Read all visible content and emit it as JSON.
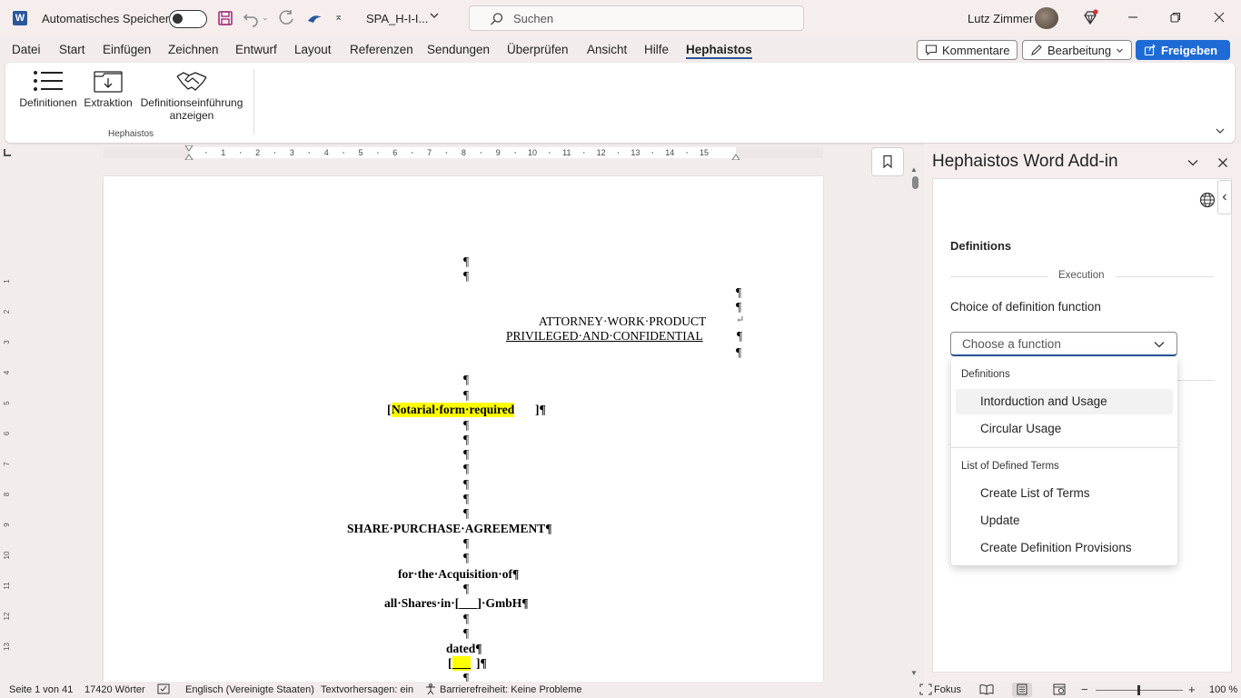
{
  "titlebar": {
    "autosave_label": "Automatisches Speichern",
    "filename": "SPA_H-I-I...",
    "search_placeholder": "Suchen",
    "user_name": "Lutz Zimmer"
  },
  "menu": {
    "tabs": [
      "Datei",
      "Start",
      "Einfügen",
      "Zeichnen",
      "Entwurf",
      "Layout",
      "Referenzen",
      "Sendungen",
      "Überprüfen",
      "Ansicht",
      "Hilfe",
      "Hephaistos"
    ],
    "comments_label": "Kommentare",
    "editing_label": "Bearbeitung",
    "share_label": "Freigeben"
  },
  "ribbon": {
    "definitions_label": "Definitionen",
    "extraction_label": "Extraktion",
    "intro_label_1": "Definitionseinführung",
    "intro_label_2": "anzeigen",
    "group_label": "Hephaistos"
  },
  "ruler": {
    "numbers": [
      "1",
      "2",
      "3",
      "4",
      "5",
      "6",
      "7",
      "8",
      "9",
      "10",
      "11",
      "12",
      "13",
      "14",
      "15"
    ],
    "vnumbers": [
      "1",
      "2",
      "3",
      "4",
      "5",
      "6",
      "7",
      "8",
      "9",
      "10",
      "11",
      "12",
      "13"
    ]
  },
  "document": {
    "pilcrow": "¶",
    "line_attorney": "ATTORNEY·WORK·PRODUCT",
    "line_return": "↵",
    "line_privileged": "PRIVILEGED·AND·CONFIDENTIAL",
    "bracket_open": "[",
    "notarial": "Notarial·form·required",
    "bracket_close_p": "]¶",
    "title": "SHARE·PURCHASE·AGREEMENT¶",
    "acquisition": "for·the·Acquisition·of¶",
    "shares": "all·Shares·in·[___]·GmbH¶",
    "dated": "dated¶",
    "date_blank": "___"
  },
  "pane": {
    "title": "Hephaistos Word Add-in",
    "section_title": "Definitions",
    "execution_label": "Execution",
    "choice_label": "Choice of definition function",
    "dropdown_placeholder": "Choose a function",
    "group1_header": "Definitions",
    "group1_options": [
      "Intorduction and Usage",
      "Circular Usage"
    ],
    "group2_header": "List of Defined Terms",
    "group2_options": [
      "Create List of Terms",
      "Update",
      "Create Definition Provisions"
    ]
  },
  "status": {
    "page": "Seite 1 von 41",
    "words": "17420 Wörter",
    "language": "Englisch (Vereinigte Staaten)",
    "prediction": "Textvorhersagen: ein",
    "accessibility": "Barrierefreiheit: Keine Probleme",
    "focus": "Fokus",
    "zoom": "100 %"
  },
  "colors": {
    "accent": "#2b579a",
    "share_button": "#1f6bd6",
    "highlight": "#ffff00"
  }
}
